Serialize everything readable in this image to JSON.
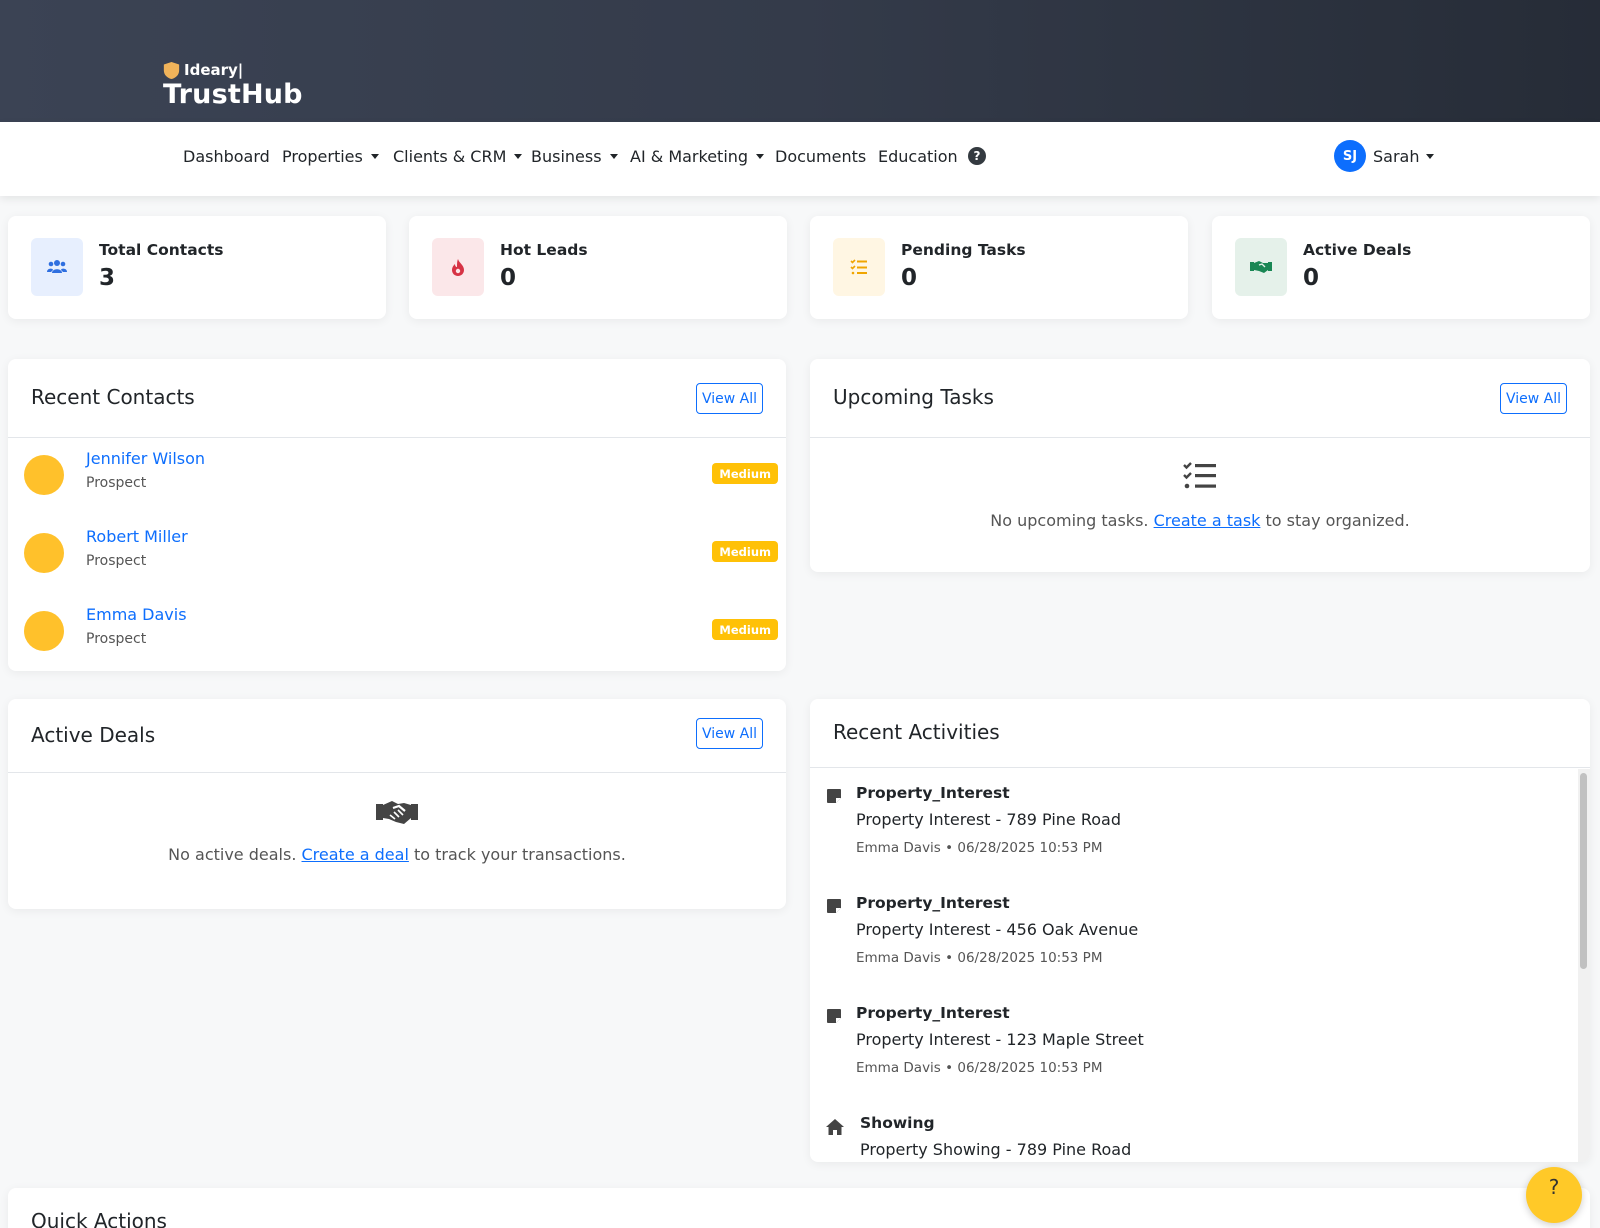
{
  "brand": {
    "top": "Ideary|",
    "main": "TrustHub"
  },
  "nav": {
    "items": [
      {
        "label": "Dashboard",
        "dropdown": false
      },
      {
        "label": "Properties",
        "dropdown": true
      },
      {
        "label": "Clients & CRM",
        "dropdown": true
      },
      {
        "label": "Business",
        "dropdown": true
      },
      {
        "label": "AI & Marketing",
        "dropdown": true
      },
      {
        "label": "Documents",
        "dropdown": false
      },
      {
        "label": "Education",
        "dropdown": false
      }
    ],
    "help_icon": "question-circle-icon",
    "user": {
      "initials": "SJ",
      "name": "Sarah"
    }
  },
  "stats": [
    {
      "label": "Total Contacts",
      "value": "3",
      "icon": "users-icon",
      "color": "#0d6efd"
    },
    {
      "label": "Hot Leads",
      "value": "0",
      "icon": "fire-icon",
      "color": "#dc3545"
    },
    {
      "label": "Pending Tasks",
      "value": "0",
      "icon": "tasks-icon",
      "color": "#ffc107"
    },
    {
      "label": "Active Deals",
      "value": "0",
      "icon": "handshake-icon",
      "color": "#198754"
    }
  ],
  "recent_contacts": {
    "title": "Recent Contacts",
    "view_all": "View All",
    "items": [
      {
        "name": "Jennifer Wilson",
        "type": "Prospect",
        "priority": "Medium"
      },
      {
        "name": "Robert Miller",
        "type": "Prospect",
        "priority": "Medium"
      },
      {
        "name": "Emma Davis",
        "type": "Prospect",
        "priority": "Medium"
      }
    ]
  },
  "upcoming_tasks": {
    "title": "Upcoming Tasks",
    "view_all": "View All",
    "empty_pre": "No upcoming tasks.",
    "empty_link": "Create a task",
    "empty_post": "to stay organized."
  },
  "active_deals": {
    "title": "Active Deals",
    "view_all": "View All",
    "empty_pre": "No active deals.",
    "empty_link": "Create a deal",
    "empty_post": "to track your transactions."
  },
  "recent_activities": {
    "title": "Recent Activities",
    "items": [
      {
        "type": "Property_Interest",
        "desc": "Property Interest - 789 Pine Road",
        "meta": "Emma Davis • 06/28/2025 10:53 PM",
        "icon": "note-icon"
      },
      {
        "type": "Property_Interest",
        "desc": "Property Interest - 456 Oak Avenue",
        "meta": "Emma Davis • 06/28/2025 10:53 PM",
        "icon": "note-icon"
      },
      {
        "type": "Property_Interest",
        "desc": "Property Interest - 123 Maple Street",
        "meta": "Emma Davis • 06/28/2025 10:53 PM",
        "icon": "note-icon"
      },
      {
        "type": "Showing",
        "desc": "Property Showing - 789 Pine Road",
        "meta": "",
        "icon": "home-icon"
      }
    ]
  },
  "quick_actions": {
    "title": "Quick Actions"
  },
  "floating_help": "?"
}
